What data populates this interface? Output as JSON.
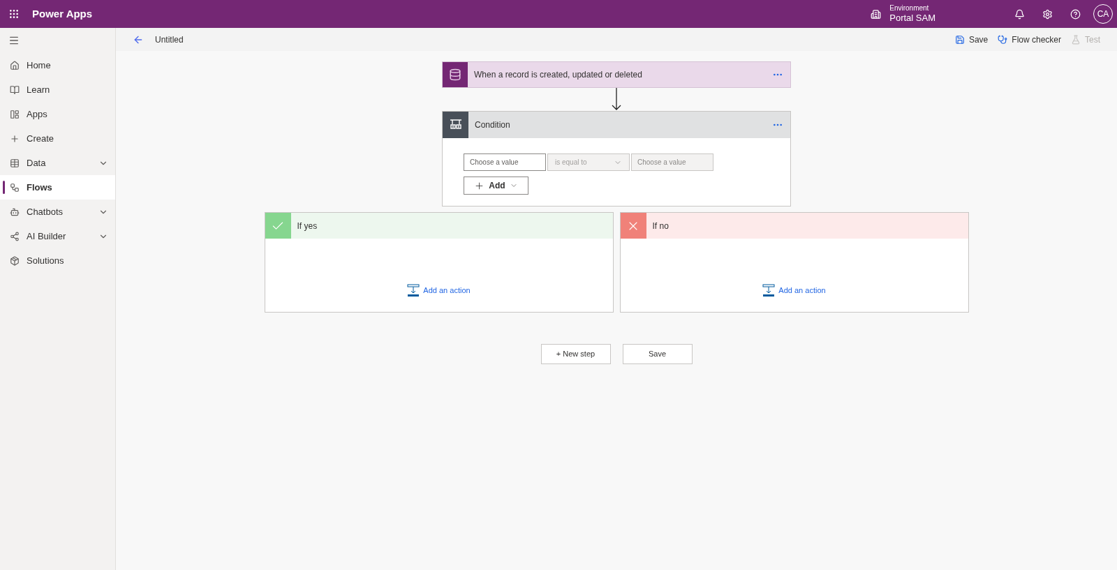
{
  "app_bar": {
    "title": "Power Apps",
    "environment_label": "Environment",
    "environment_name": "Portal SAM",
    "avatar": "CA"
  },
  "sidebar": {
    "items": [
      {
        "label": "Home",
        "expandable": false,
        "selected": false
      },
      {
        "label": "Learn",
        "expandable": false,
        "selected": false
      },
      {
        "label": "Apps",
        "expandable": false,
        "selected": false
      },
      {
        "label": "Create",
        "expandable": false,
        "selected": false
      },
      {
        "label": "Data",
        "expandable": true,
        "selected": false
      },
      {
        "label": "Flows",
        "expandable": false,
        "selected": true
      },
      {
        "label": "Chatbots",
        "expandable": true,
        "selected": false
      },
      {
        "label": "AI Builder",
        "expandable": true,
        "selected": false
      },
      {
        "label": "Solutions",
        "expandable": false,
        "selected": false
      }
    ]
  },
  "command_bar": {
    "title": "Untitled",
    "actions": [
      {
        "label": "Save",
        "disabled": false
      },
      {
        "label": "Flow checker",
        "disabled": false
      },
      {
        "label": "Test",
        "disabled": true
      }
    ]
  },
  "trigger": {
    "title": "When a record is created, updated or deleted"
  },
  "condition": {
    "title": "Condition",
    "left_placeholder": "Choose a value",
    "operator": "is equal to",
    "right_placeholder": "Choose a value",
    "add_label": "Add"
  },
  "branches": [
    {
      "kind": "yes",
      "title": "If yes",
      "action": "Add an action"
    },
    {
      "kind": "no",
      "title": "If no",
      "action": "Add an action"
    }
  ],
  "footer_buttons": [
    "+ New step",
    "Save"
  ]
}
